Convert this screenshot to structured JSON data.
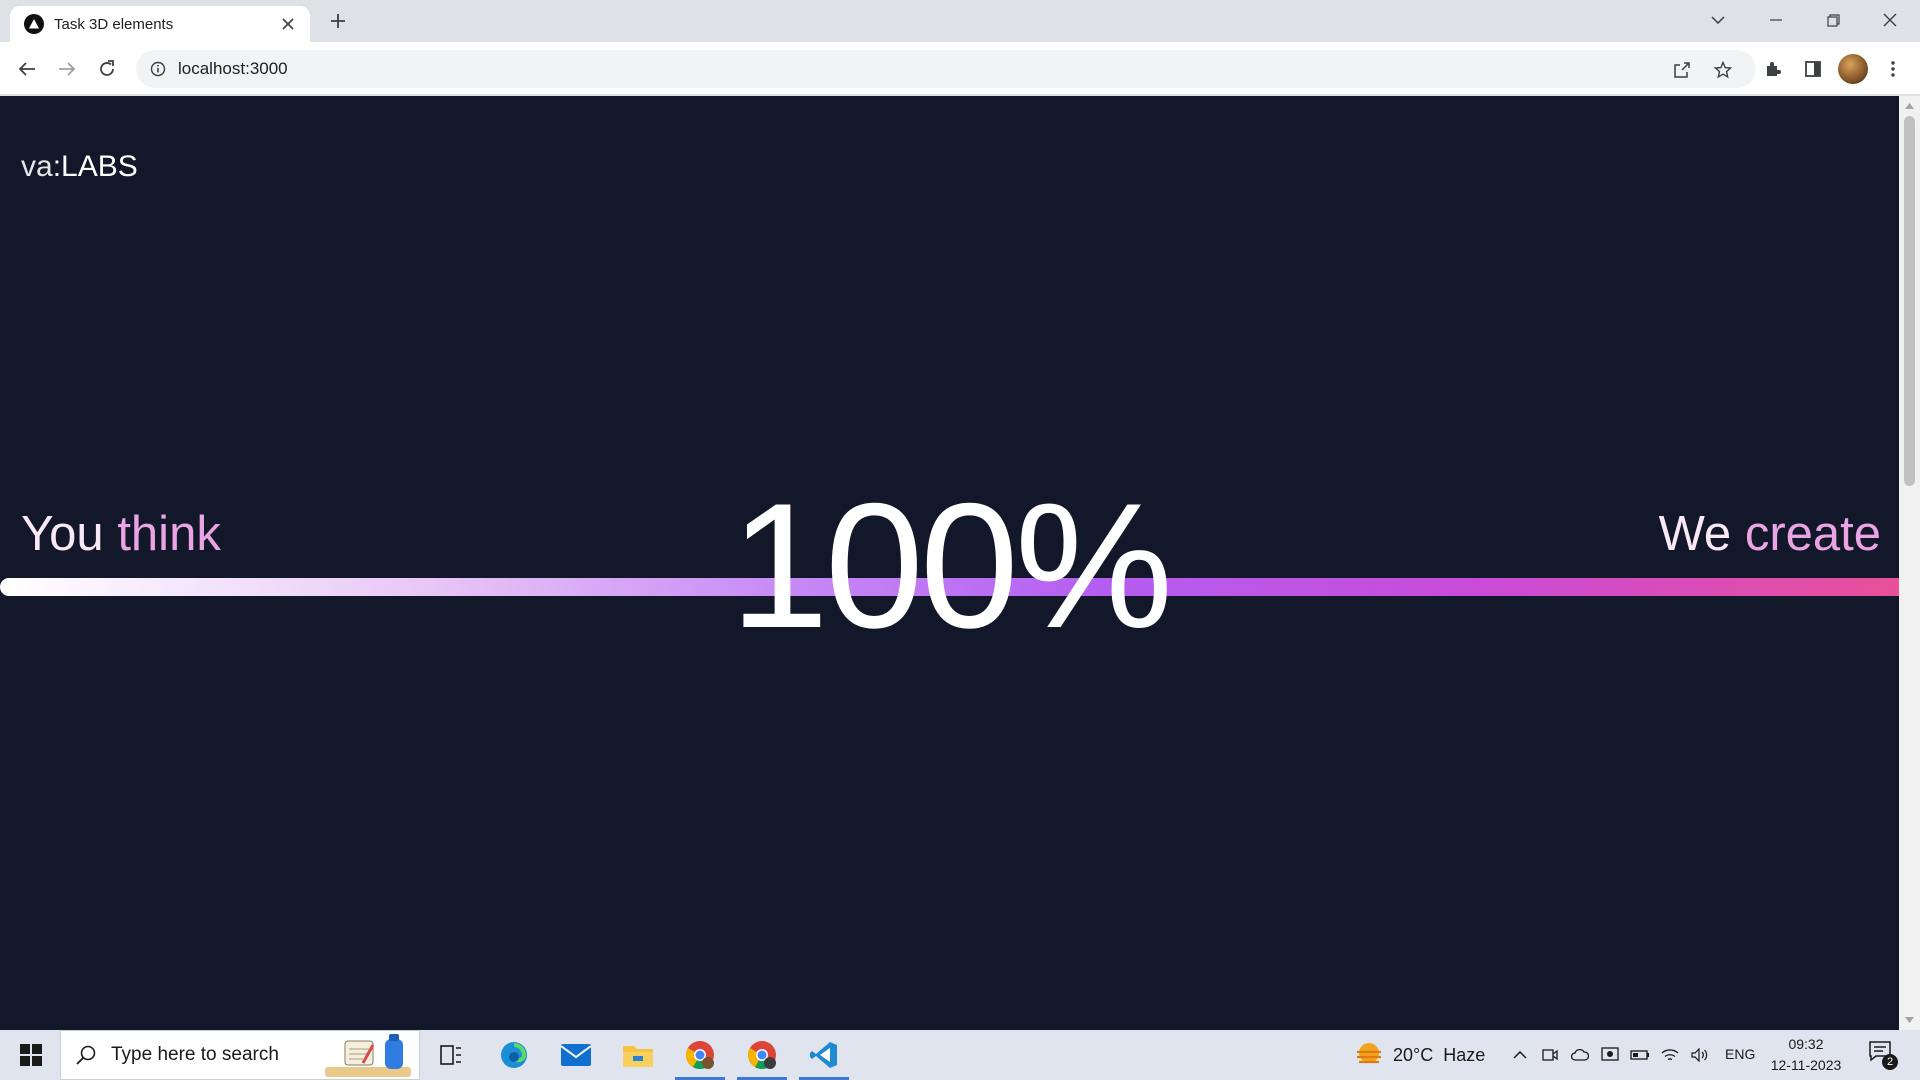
{
  "browser": {
    "tab_title": "Task 3D elements",
    "url": "localhost:3000"
  },
  "page": {
    "brand_prefix": "va",
    "brand_suffix": ":LABS",
    "left_word_1": "You",
    "left_word_2": "think",
    "right_word_1": "We",
    "right_word_2": "create",
    "percent_label": "100%",
    "progress_fraction": 1.0,
    "colors": {
      "background": "#121829",
      "accent_pink": "#eaa3e3",
      "gradient_start": "#ffffff",
      "gradient_mid": "#b35ef0",
      "gradient_end": "#e94f9a"
    }
  },
  "taskbar": {
    "search_placeholder": "Type here to search",
    "weather_temp": "20°C",
    "weather_desc": "Haze",
    "language": "ENG",
    "time": "09:32",
    "date": "12-11-2023",
    "notification_count": "2"
  }
}
